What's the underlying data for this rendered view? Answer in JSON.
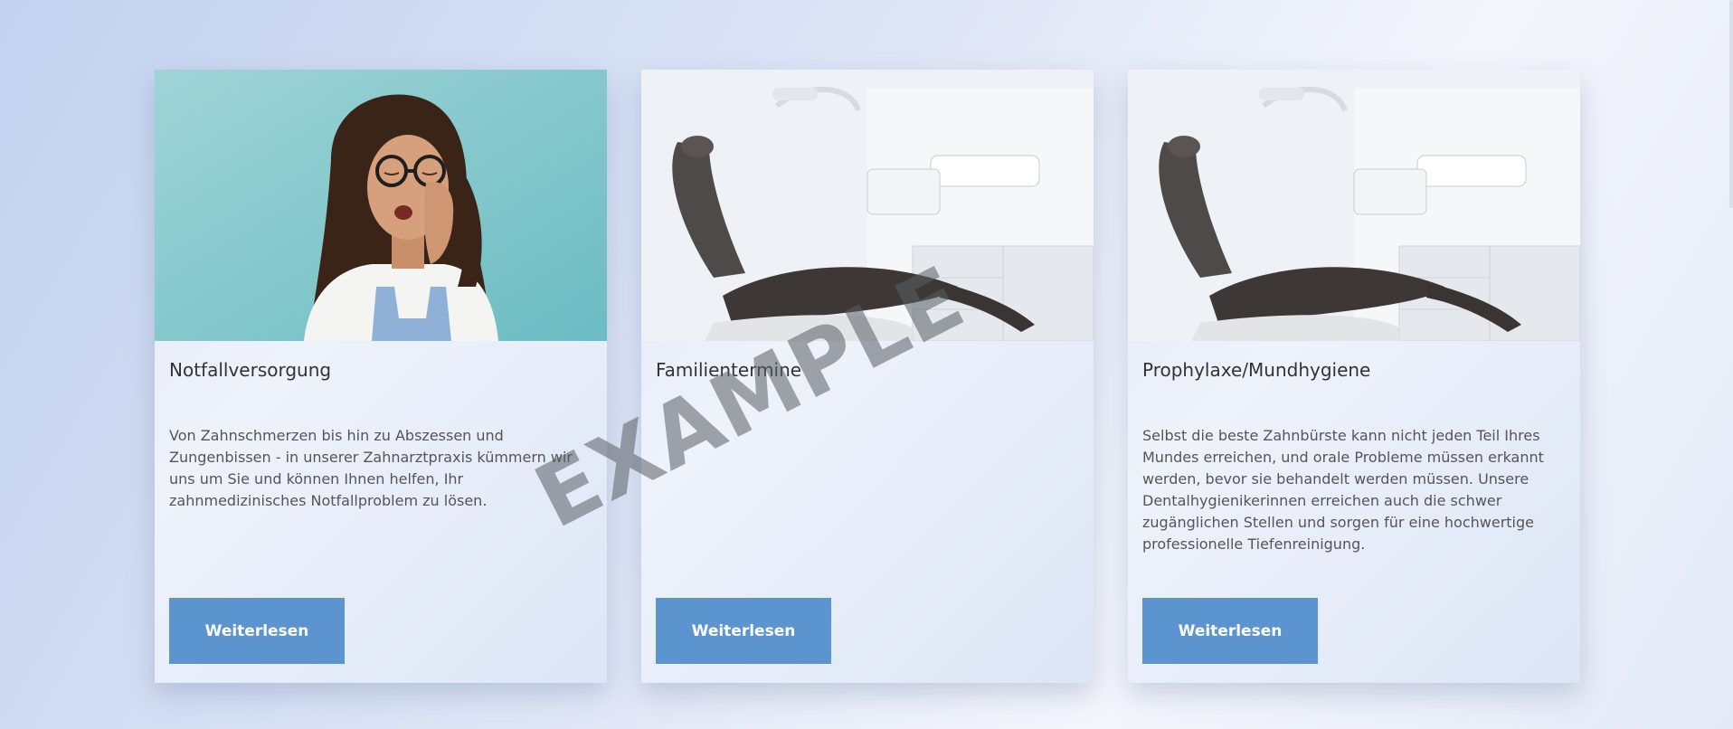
{
  "cards": [
    {
      "title": "Notfallversorgung",
      "text": "Von Zahnschmerzen bis hin zu Abszessen und Zungenbissen - in unserer Zahnarztpraxis kümmern wir uns um Sie und können Ihnen helfen, Ihr zahnmedizinisches Notfallproblem zu lösen.",
      "button": "Weiterlesen",
      "image": "girl-with-toothache-photo"
    },
    {
      "title": "Familientermine",
      "text": "",
      "button": "Weiterlesen",
      "image": "dental-chair-photo"
    },
    {
      "title": "Prophylaxe/Mundhygiene",
      "text": "Selbst die beste Zahnbürste kann nicht jeden Teil Ihres Mundes erreichen, und orale Probleme müssen erkannt werden, bevor sie behandelt werden müssen. Unsere Dentalhygienikerinnen erreichen auch die schwer zugänglichen Stellen und sorgen für eine hochwertige professionelle Tiefenreinigung.",
      "button": "Weiterlesen",
      "image": "dental-chair-photo"
    }
  ],
  "watermark": "EXAMPLE",
  "colors": {
    "button": "#5c94d0",
    "card": "#e4eaf8",
    "background": "#c9d6f0"
  }
}
